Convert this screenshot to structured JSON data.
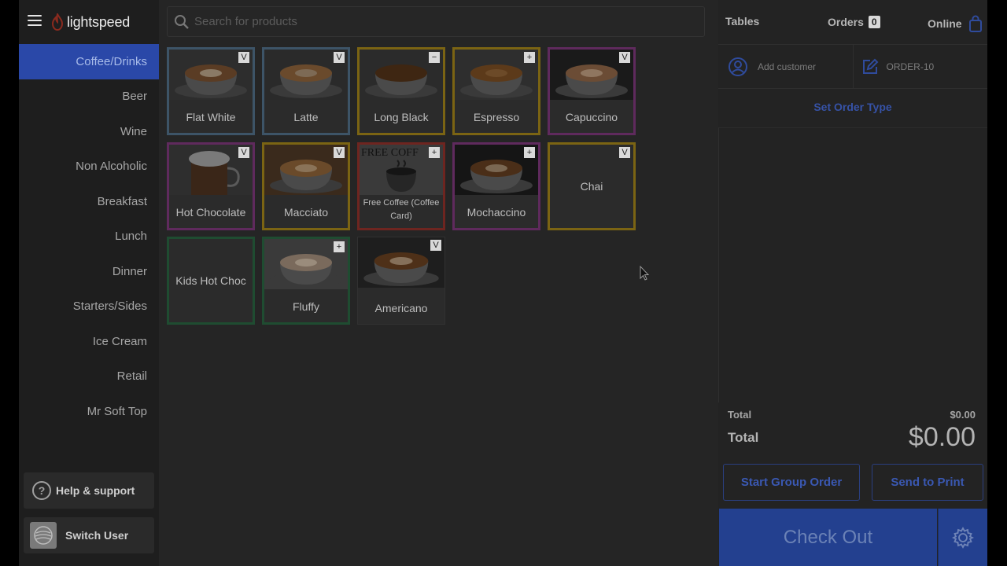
{
  "brand": {
    "logo_text": "lightspeed"
  },
  "sidebar": {
    "categories": [
      {
        "label": "Coffee/Drinks",
        "active": true
      },
      {
        "label": "Beer"
      },
      {
        "label": "Wine"
      },
      {
        "label": "Non Alcoholic"
      },
      {
        "label": "Breakfast"
      },
      {
        "label": "Lunch"
      },
      {
        "label": "Dinner"
      },
      {
        "label": "Starters/Sides"
      },
      {
        "label": "Ice Cream"
      },
      {
        "label": "Retail"
      },
      {
        "label": "Mr Soft Top"
      }
    ],
    "help_label": "Help & support",
    "help_icon_glyph": "?",
    "switch_user_label": "Switch User"
  },
  "search": {
    "placeholder": "Search for products"
  },
  "products": [
    {
      "name": "Flat White",
      "badge": "V",
      "border": "blue",
      "image": "latte-art-cup"
    },
    {
      "name": "Latte",
      "badge": "V",
      "border": "blue",
      "image": "latte-glass"
    },
    {
      "name": "Long Black",
      "badge": "−",
      "border": "yellow",
      "image": "black-coffee-cup"
    },
    {
      "name": "Espresso",
      "badge": "+",
      "border": "yellow",
      "image": "espresso-cup"
    },
    {
      "name": "Capuccino",
      "badge": "V",
      "border": "purple",
      "image": "cappuccino-cup"
    },
    {
      "name": "Hot Chocolate",
      "badge": "V",
      "border": "purple",
      "image": "hot-chocolate-mug"
    },
    {
      "name": "Macciato",
      "badge": "V",
      "border": "yellow",
      "image": "macchiato-glass"
    },
    {
      "name": "Free Coffee (Coffee Card)",
      "badge": "+",
      "border": "red",
      "image": "free-coffee-card",
      "image_text": "FREE COFF"
    },
    {
      "name": "Mochaccino",
      "badge": "+",
      "border": "purple",
      "image": "mochaccino-cup"
    },
    {
      "name": "Chai",
      "badge": "V",
      "border": "yellow",
      "image": null
    },
    {
      "name": "Kids Hot Choc",
      "badge": null,
      "border": "green",
      "image": null
    },
    {
      "name": "Fluffy",
      "badge": "+",
      "border": "green",
      "image": "fluffy-cup"
    },
    {
      "name": "Americano",
      "badge": "V",
      "border": "gray",
      "image": "americano-cup"
    }
  ],
  "order": {
    "tables_label": "Tables",
    "orders_label": "Orders",
    "orders_count": "0",
    "online_label": "Online",
    "add_customer_label": "Add customer",
    "order_id": "ORDER-10",
    "set_order_type_label": "Set Order Type",
    "subtotal_label": "Total",
    "subtotal_value": "$0.00",
    "total_label": "Total",
    "total_value": "$0.00",
    "start_group_order_label": "Start Group Order",
    "send_to_print_label": "Send to Print",
    "checkout_label": "Check Out"
  },
  "colors": {
    "accent": "#2a48a8",
    "border_blue": "#3d5467",
    "border_yellow": "#7b6413",
    "border_purple": "#5f2a5d",
    "border_red": "#6e2520",
    "border_green": "#1f4c31"
  }
}
